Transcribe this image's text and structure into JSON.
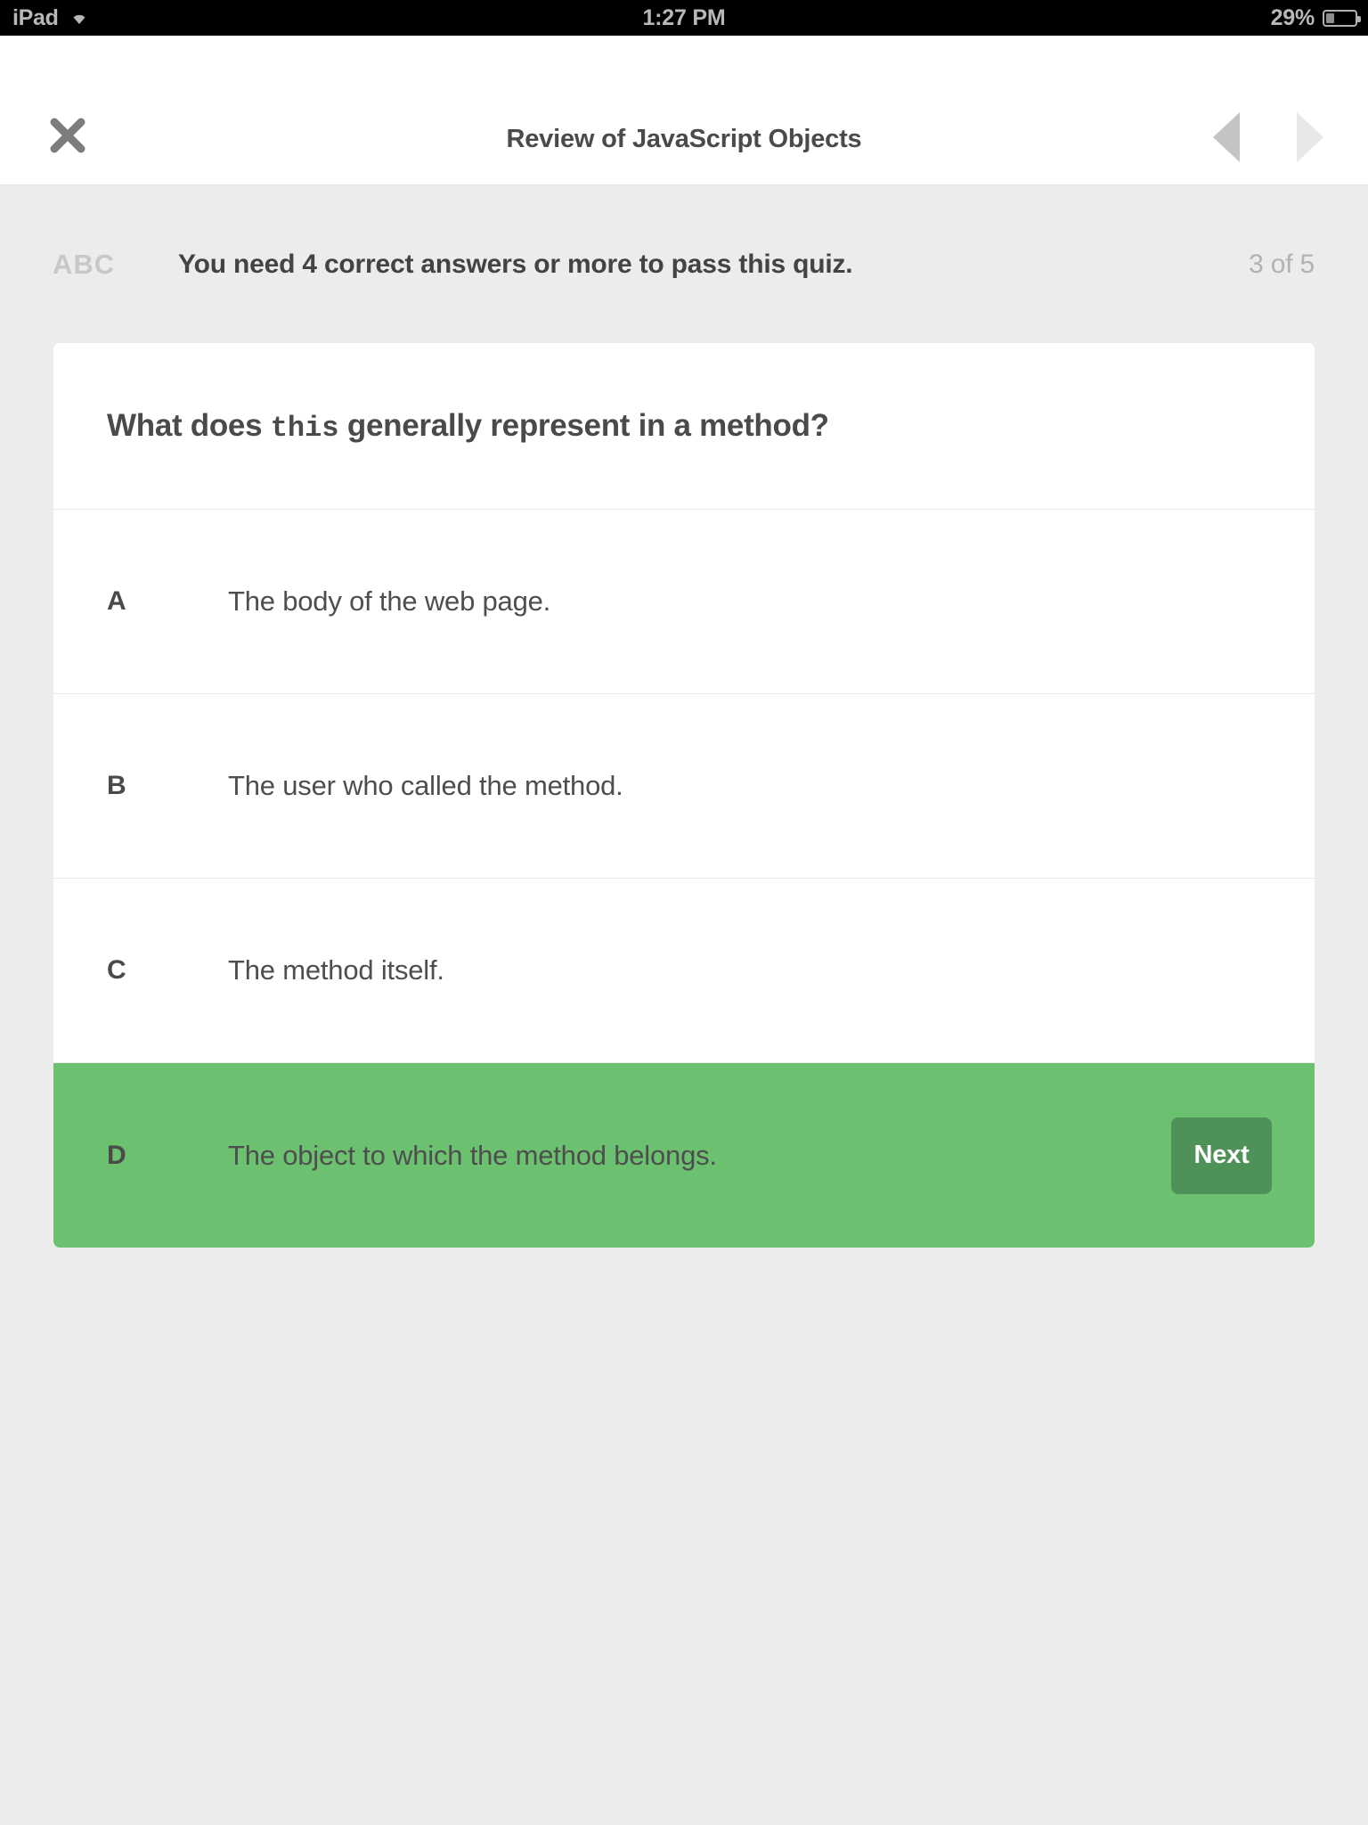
{
  "status_bar": {
    "carrier": "iPad",
    "wifi_icon": "wifi-icon",
    "time": "1:27 PM",
    "battery_percent": "29%",
    "battery_level": 29,
    "battery_icon": "battery-icon"
  },
  "navbar": {
    "close_icon": "close-x-icon",
    "title": "Review of JavaScript Objects",
    "prev_icon": "triangle-left-icon",
    "next_icon": "triangle-right-icon",
    "prev_enabled": true,
    "next_enabled": false
  },
  "quiz_meta": {
    "badge_label": "ABC",
    "pass_requirement": "You need 4 correct answers or more to pass this quiz.",
    "progress": "3 of 5",
    "current_question": 3,
    "total_questions": 5
  },
  "question": {
    "prefix": "What does ",
    "code": "this",
    "suffix": " generally represent in a method?"
  },
  "answers": [
    {
      "letter": "A",
      "text": "The body of the web page.",
      "selected": false
    },
    {
      "letter": "B",
      "text": "The user who called the method.",
      "selected": false
    },
    {
      "letter": "C",
      "text": "The method itself.",
      "selected": false
    },
    {
      "letter": "D",
      "text": "The object to which the method belongs.",
      "selected": true
    }
  ],
  "next_button": {
    "label": "Next"
  },
  "colors": {
    "page_background": "#ececec",
    "card_background": "#ffffff",
    "selected_answer": "#6bc16f",
    "next_button": "#4f9259",
    "text_primary": "#4a4a4a",
    "text_muted": "#b2b2b2",
    "status_bar": "#000000"
  }
}
